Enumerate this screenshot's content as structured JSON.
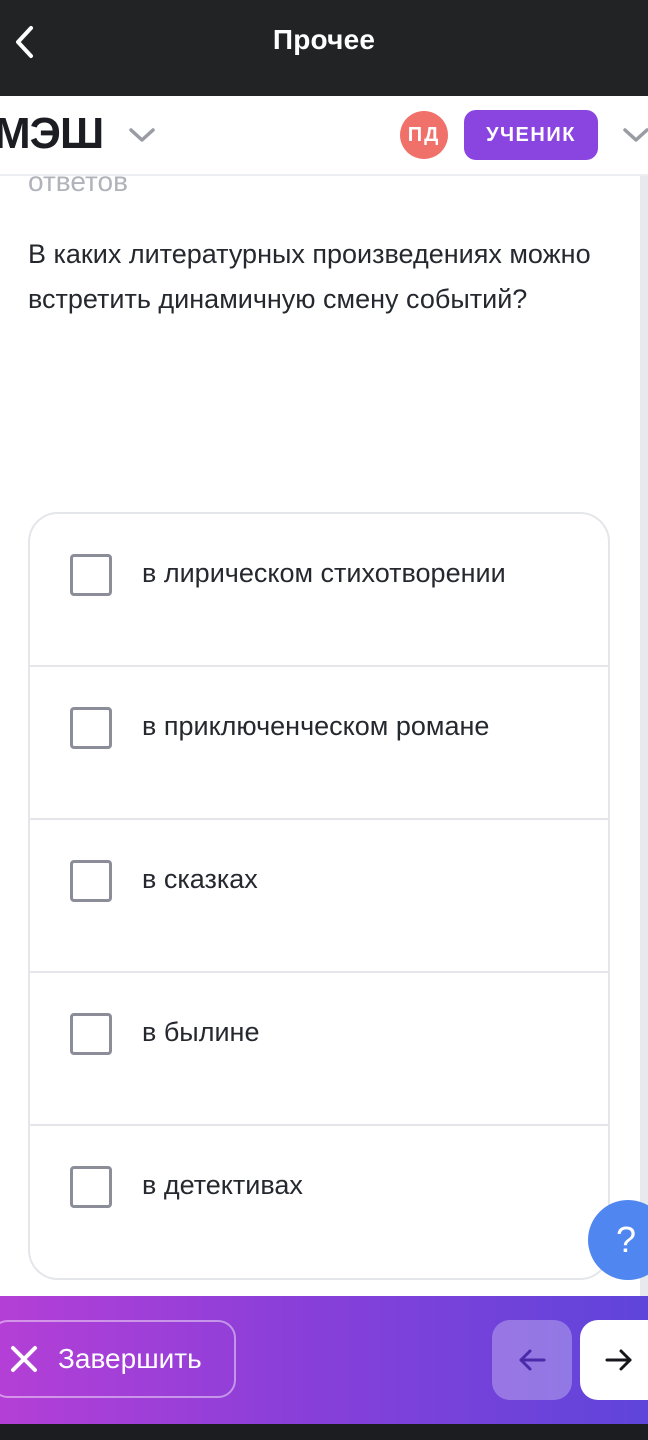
{
  "header": {
    "title": "Прочее"
  },
  "appbar": {
    "logo": "МЭШ",
    "avatar_initials": "ПД",
    "role": "УЧЕНИК"
  },
  "question": {
    "faded_text": "ответов",
    "text": "В каких литературных произведениях можно встретить динамичную смену событий?"
  },
  "options": [
    {
      "label": "в лирическом стихотворении",
      "checked": false
    },
    {
      "label": "в приключенческом романе",
      "checked": false
    },
    {
      "label": "в сказках",
      "checked": false
    },
    {
      "label": "в былине",
      "checked": false
    },
    {
      "label": "в детективах",
      "checked": false
    }
  ],
  "help": {
    "icon_label": "?"
  },
  "footer": {
    "finish_label": "Завершить"
  },
  "colors": {
    "header_bg": "#222324",
    "role_badge": "#8a44e0",
    "avatar": "#f0706a",
    "help_button": "#4f86f0",
    "footer_gradient_start": "#b43fd6",
    "footer_gradient_end": "#5f45db"
  }
}
